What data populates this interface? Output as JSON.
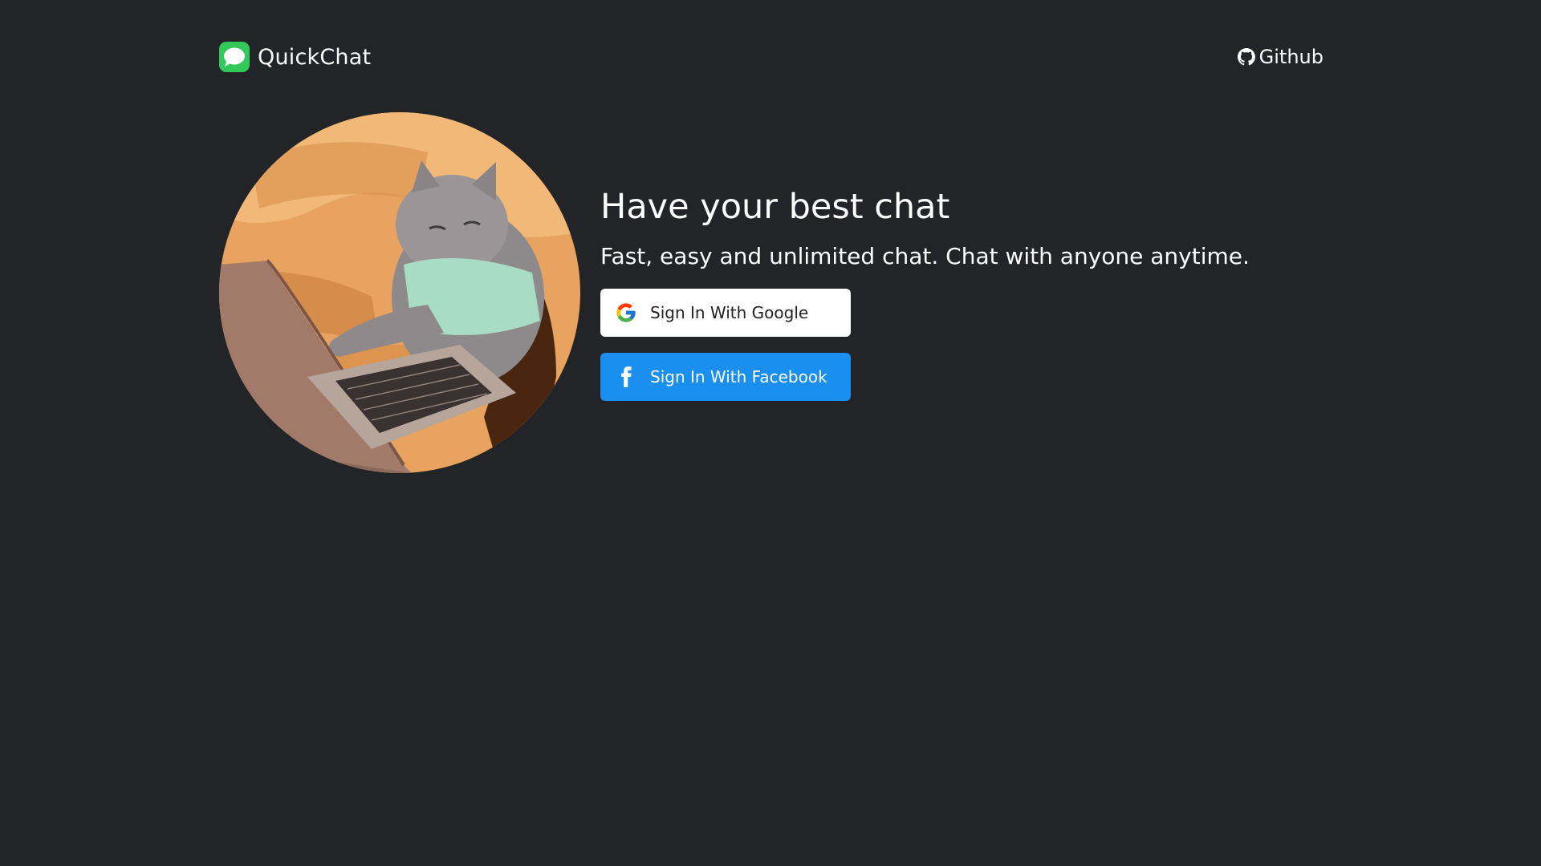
{
  "header": {
    "brand_name": "QuickChat",
    "brand_icon": "chat-bubble-icon",
    "github_label": "Github",
    "github_icon": "github-icon"
  },
  "hero": {
    "title": "Have your best chat",
    "subtitle": "Fast, easy and unlimited chat. Chat with anyone anytime.",
    "image": "cat-typing-on-laptop"
  },
  "auth": {
    "google_label": "Sign In With Google",
    "google_icon": "google-icon",
    "facebook_label": "Sign In With Facebook",
    "facebook_icon": "facebook-icon"
  },
  "colors": {
    "background": "#232427",
    "brand_icon_green": "#34c759",
    "facebook_blue": "#1a8ff0",
    "text": "#ffffff"
  }
}
